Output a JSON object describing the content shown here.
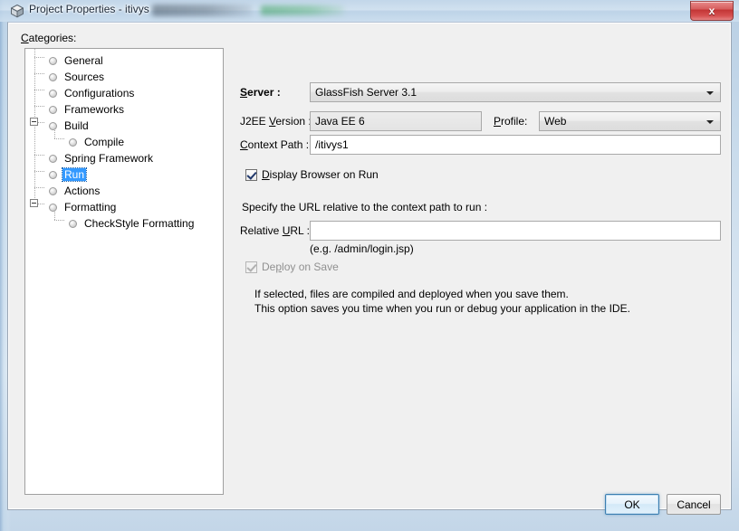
{
  "window": {
    "title": "Project Properties - itivys",
    "icon": "cube-icon",
    "close_label": "x"
  },
  "categories": {
    "label": "Categories:",
    "label_mnemonic": "C",
    "items": [
      {
        "label": "General",
        "depth": 0,
        "selected": false,
        "expandable": false
      },
      {
        "label": "Sources",
        "depth": 0,
        "selected": false,
        "expandable": false
      },
      {
        "label": "Configurations",
        "depth": 0,
        "selected": false,
        "expandable": false
      },
      {
        "label": "Frameworks",
        "depth": 0,
        "selected": false,
        "expandable": false
      },
      {
        "label": "Build",
        "depth": 0,
        "selected": false,
        "expandable": true
      },
      {
        "label": "Compile",
        "depth": 1,
        "selected": false,
        "expandable": false
      },
      {
        "label": "Spring Framework",
        "depth": 0,
        "selected": false,
        "expandable": false
      },
      {
        "label": "Run",
        "depth": 0,
        "selected": true,
        "expandable": false
      },
      {
        "label": "Actions",
        "depth": 0,
        "selected": false,
        "expandable": false
      },
      {
        "label": "Formatting",
        "depth": 0,
        "selected": false,
        "expandable": true
      },
      {
        "label": "CheckStyle Formatting",
        "depth": 1,
        "selected": false,
        "expandable": false
      }
    ]
  },
  "form": {
    "server": {
      "label_prefix": "S",
      "label_rest": "erver :",
      "value": "GlassFish Server 3.1"
    },
    "j2ee_version": {
      "label_pre": "J2EE ",
      "label_mnemonic": "V",
      "label_post": "ersion :",
      "value": "Java EE 6"
    },
    "profile": {
      "label_mnemonic": "P",
      "label_post": "rofile:",
      "value": "Web"
    },
    "context_path": {
      "label_mnemonic": "C",
      "label_post": "ontext Path :",
      "value": "/itivys1"
    },
    "display_browser": {
      "label_pre": "",
      "label_mnemonic": "D",
      "label_post": "isplay Browser on Run",
      "checked": true,
      "enabled": true
    },
    "url_hint": "Specify the URL relative to the context path to run :",
    "relative_url": {
      "label_pre": "Relative ",
      "label_mnemonic": "U",
      "label_post": "RL :",
      "value": "",
      "placeholder": ""
    },
    "url_example": "(e.g. /admin/login.jsp)",
    "deploy_on_save": {
      "label_pre": "De",
      "label_mnemonic": "p",
      "label_post": "loy on Save",
      "checked": true,
      "enabled": false
    },
    "deploy_desc_line1": "If selected, files are compiled and deployed when you save them.",
    "deploy_desc_line2": "This option saves you time when you run or debug your application in the IDE."
  },
  "buttons": {
    "ok": "OK",
    "cancel": "Cancel"
  },
  "colors": {
    "selection": "#3399ff",
    "accent": "#3c7fb1",
    "close": "#c23434",
    "panel": "#f0f0f0"
  }
}
